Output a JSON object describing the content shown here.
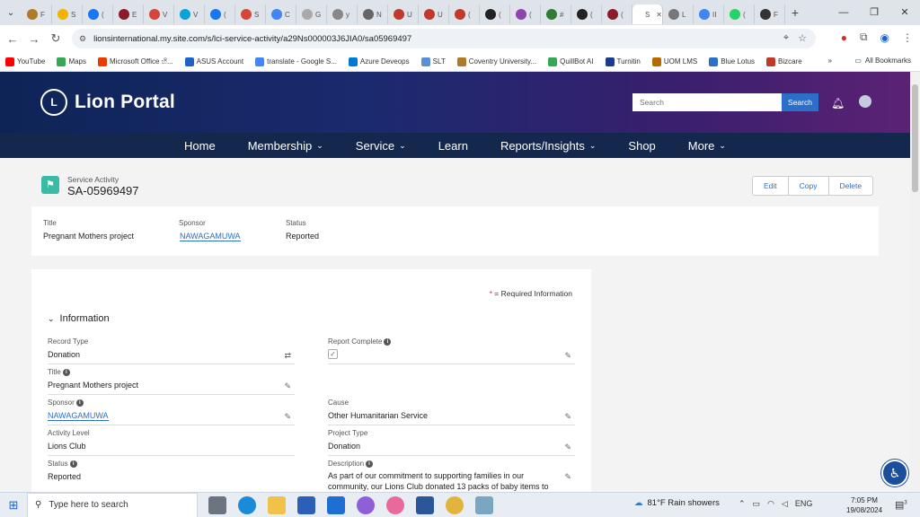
{
  "browser": {
    "tab_labels": [
      "F",
      "S",
      "(",
      "E",
      "V",
      "V",
      "(",
      "S",
      "C",
      "G",
      "y",
      "N",
      "U",
      "U",
      "(",
      "(",
      "(",
      "#",
      "(",
      "(",
      "S",
      "L",
      "II",
      "(",
      "F"
    ],
    "url": "lionsinternational.my.site.com/s/lci-service-activity/a29Ns000003J6JIA0/sa05969497",
    "bookmarks": [
      "YouTube",
      "Maps",
      "Microsoft Office හි...",
      "ASUS Account",
      "translate - Google S...",
      "Azure Deveops",
      "SLT",
      "Coventry University...",
      "QuillBot AI",
      "Turnitin",
      "UOM LMS",
      "Blue Lotus",
      "Bizcare"
    ],
    "all_bookmarks": "All Bookmarks"
  },
  "header": {
    "logo_text": "Lion Portal",
    "search_placeholder": "Search",
    "search_button": "Search"
  },
  "nav": [
    {
      "label": "Home",
      "dropdown": false
    },
    {
      "label": "Membership",
      "dropdown": true
    },
    {
      "label": "Service",
      "dropdown": true
    },
    {
      "label": "Learn",
      "dropdown": false
    },
    {
      "label": "Reports/Insights",
      "dropdown": true
    },
    {
      "label": "Shop",
      "dropdown": false
    },
    {
      "label": "More",
      "dropdown": true
    }
  ],
  "record": {
    "type": "Service Activity",
    "id": "SA-05969497",
    "actions": {
      "edit": "Edit",
      "copy": "Copy",
      "delete": "Delete"
    }
  },
  "highlights": {
    "title_label": "Title",
    "title_value": "Pregnant Mothers project",
    "sponsor_label": "Sponsor",
    "sponsor_value": "NAWAGAMUWA",
    "status_label": "Status",
    "status_value": "Reported"
  },
  "detail": {
    "required_star": "*",
    "required_text": "= Required Information",
    "section_title": "Information",
    "fields": {
      "record_type_label": "Record Type",
      "record_type_value": "Donation",
      "report_complete_label": "Report Complete",
      "title_label": "Title",
      "title_value": "Pregnant Mothers project",
      "sponsor_label": "Sponsor",
      "sponsor_value": "NAWAGAMUWA",
      "cause_label": "Cause",
      "cause_value": "Other Humanitarian Service",
      "activity_level_label": "Activity Level",
      "activity_level_value": "Lions Club",
      "project_type_label": "Project Type",
      "project_type_value": "Donation",
      "status_label": "Status",
      "status_value": "Reported",
      "description_label": "Description",
      "description_value": "As part of our commitment to supporting families in our community, our Lions Club donated 13 packs of baby items to"
    }
  },
  "taskbar": {
    "search_text": "Type here to search",
    "weather": "81°F  Rain showers",
    "lang": "ENG",
    "time": "7:05 PM",
    "date": "19/08/2024",
    "notif_count": "3"
  }
}
